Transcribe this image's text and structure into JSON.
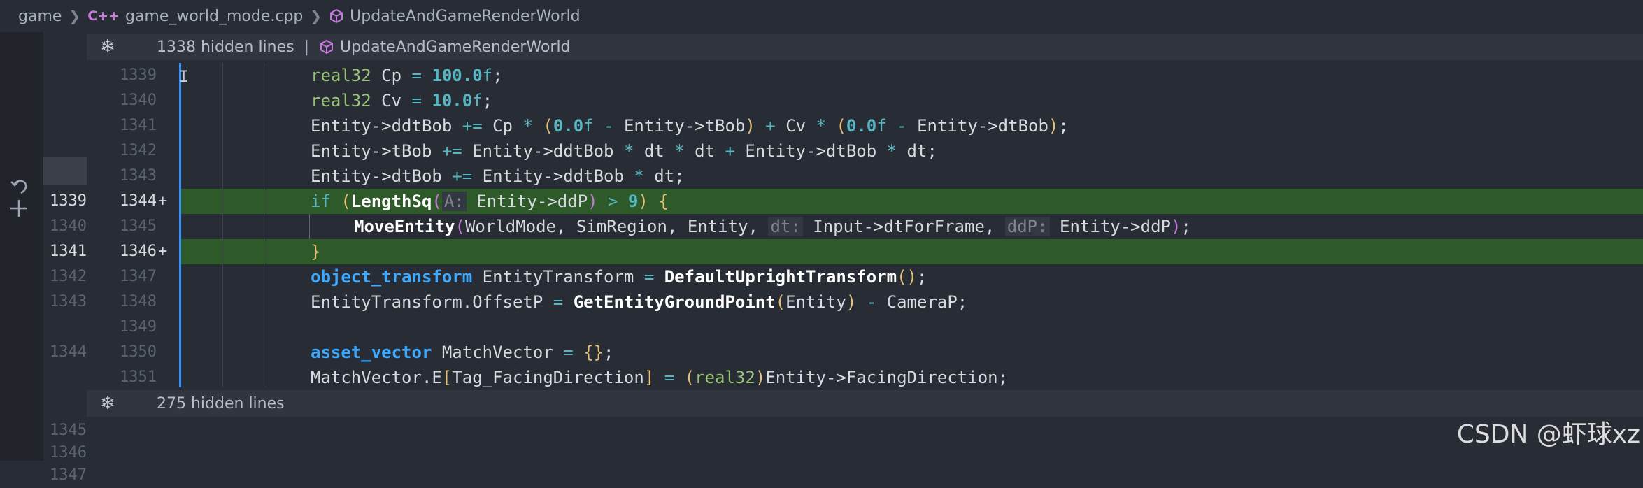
{
  "breadcrumb": {
    "folder": "game",
    "file_icon_text": "C++",
    "file": "game_world_mode.cpp",
    "symbol": "UpdateAndGameRenderWorld"
  },
  "fold_top": {
    "count": "1338 hidden lines",
    "pipe": "|",
    "symbol": "UpdateAndGameRenderWorld"
  },
  "fold_bottom": {
    "count": "275 hidden lines"
  },
  "lines": [
    {
      "old": "",
      "new": "1339",
      "plus": "",
      "added": false
    },
    {
      "old": "",
      "new": "1340",
      "plus": "",
      "added": false
    },
    {
      "old": "",
      "new": "1341",
      "plus": "",
      "added": false
    },
    {
      "old": "",
      "new": "1342",
      "plus": "",
      "added": false
    },
    {
      "old": "",
      "new": "1343",
      "plus": "",
      "added": false
    },
    {
      "old": "1339",
      "new": "1344",
      "plus": "+",
      "added": true
    },
    {
      "old": "1340",
      "new": "1345",
      "plus": "",
      "added": false
    },
    {
      "old": "1341",
      "new": "1346",
      "plus": "+",
      "added": true
    },
    {
      "old": "1342",
      "new": "1347",
      "plus": "",
      "added": false
    },
    {
      "old": "1343",
      "new": "1348",
      "plus": "",
      "added": false
    },
    {
      "old": "",
      "new": "1349",
      "plus": "",
      "added": false
    },
    {
      "old": "1344",
      "new": "1350",
      "plus": "",
      "added": false
    },
    {
      "old": "",
      "new": "1351",
      "plus": "",
      "added": false
    }
  ],
  "tail_lines": [
    "1345",
    "1346",
    "1347"
  ],
  "code": {
    "l1339": {
      "t1": "real32",
      "t2": " Cp ",
      "t3": "=",
      "t4": " ",
      "t5": "100.0",
      "t6": "f",
      "t7": ";"
    },
    "l1340": {
      "t1": "real32",
      "t2": " Cv ",
      "t3": "=",
      "t4": " ",
      "t5": "10.0",
      "t6": "f",
      "t7": ";"
    },
    "l1341": {
      "a": "Entity->ddtBob ",
      "b": "+=",
      "c": " Cp ",
      "d": "*",
      "e": " ",
      "f": "(",
      "g": "0.0",
      "h": "f",
      "i": " - ",
      "j": "Entity->tBob",
      "k": ")",
      "l": " + ",
      "m": "Cv ",
      "n": "*",
      "o": " ",
      "p": "(",
      "q": "0.0",
      "r": "f",
      "s": " - ",
      "t": "Entity->dtBob",
      "u": ")",
      "v": ";"
    },
    "l1342": {
      "a": "Entity->tBob ",
      "b": "+=",
      "c": " Entity->ddtBob ",
      "d": "*",
      "e": " dt ",
      "f": "*",
      "g": " dt ",
      "h": "+",
      "i": " Entity->dtBob ",
      "j": "*",
      "k": " dt;"
    },
    "l1343": {
      "a": "Entity->dtBob ",
      "b": "+=",
      "c": " Entity->ddtBob ",
      "d": "*",
      "e": " dt;"
    },
    "l1344": {
      "a": "if",
      "b": " ",
      "c": "(",
      "d": "LengthSq",
      "e": "(",
      "f": "A:",
      "g": " Entity->ddP",
      "h": ")",
      "i": " > ",
      "j": "9",
      "k": ")",
      "l": " {"
    },
    "l1345": {
      "a": "MoveEntity",
      "b": "(",
      "c": "WorldMode, SimRegion, Entity, ",
      "d": "dt:",
      "e": " Input->dtForFrame, ",
      "f": "ddP:",
      "g": " Entity->ddP",
      "h": ")",
      "i": ";"
    },
    "l1346": {
      "a": "}"
    },
    "l1347": {
      "a": "object_transform",
      "b": " EntityTransform ",
      "c": "=",
      "d": " ",
      "e": "DefaultUprightTransform",
      "f": "()",
      "g": ";"
    },
    "l1348": {
      "a": "EntityTransform.OffsetP ",
      "b": "=",
      "c": " ",
      "d": "GetEntityGroundPoint",
      "e": "(",
      "f": "Entity",
      "g": ")",
      "h": " - ",
      "i": "CameraP;"
    },
    "l1350": {
      "a": "asset_vector",
      "b": " MatchVector ",
      "c": "=",
      "d": " ",
      "e": "{}",
      "f": ";"
    },
    "l1351": {
      "a": "MatchVector.E",
      "b": "[",
      "c": "Tag_FacingDirection",
      "d": "]",
      "e": " = ",
      "f": "(",
      "g": "real32",
      "h": ")",
      "i": "Entity->FacingDirection;"
    }
  },
  "watermark": "CSDN @虾球xz",
  "colors": {
    "background": "#282c34",
    "added_line": "#2e5a2a",
    "modified_bar": "#3794ff"
  }
}
